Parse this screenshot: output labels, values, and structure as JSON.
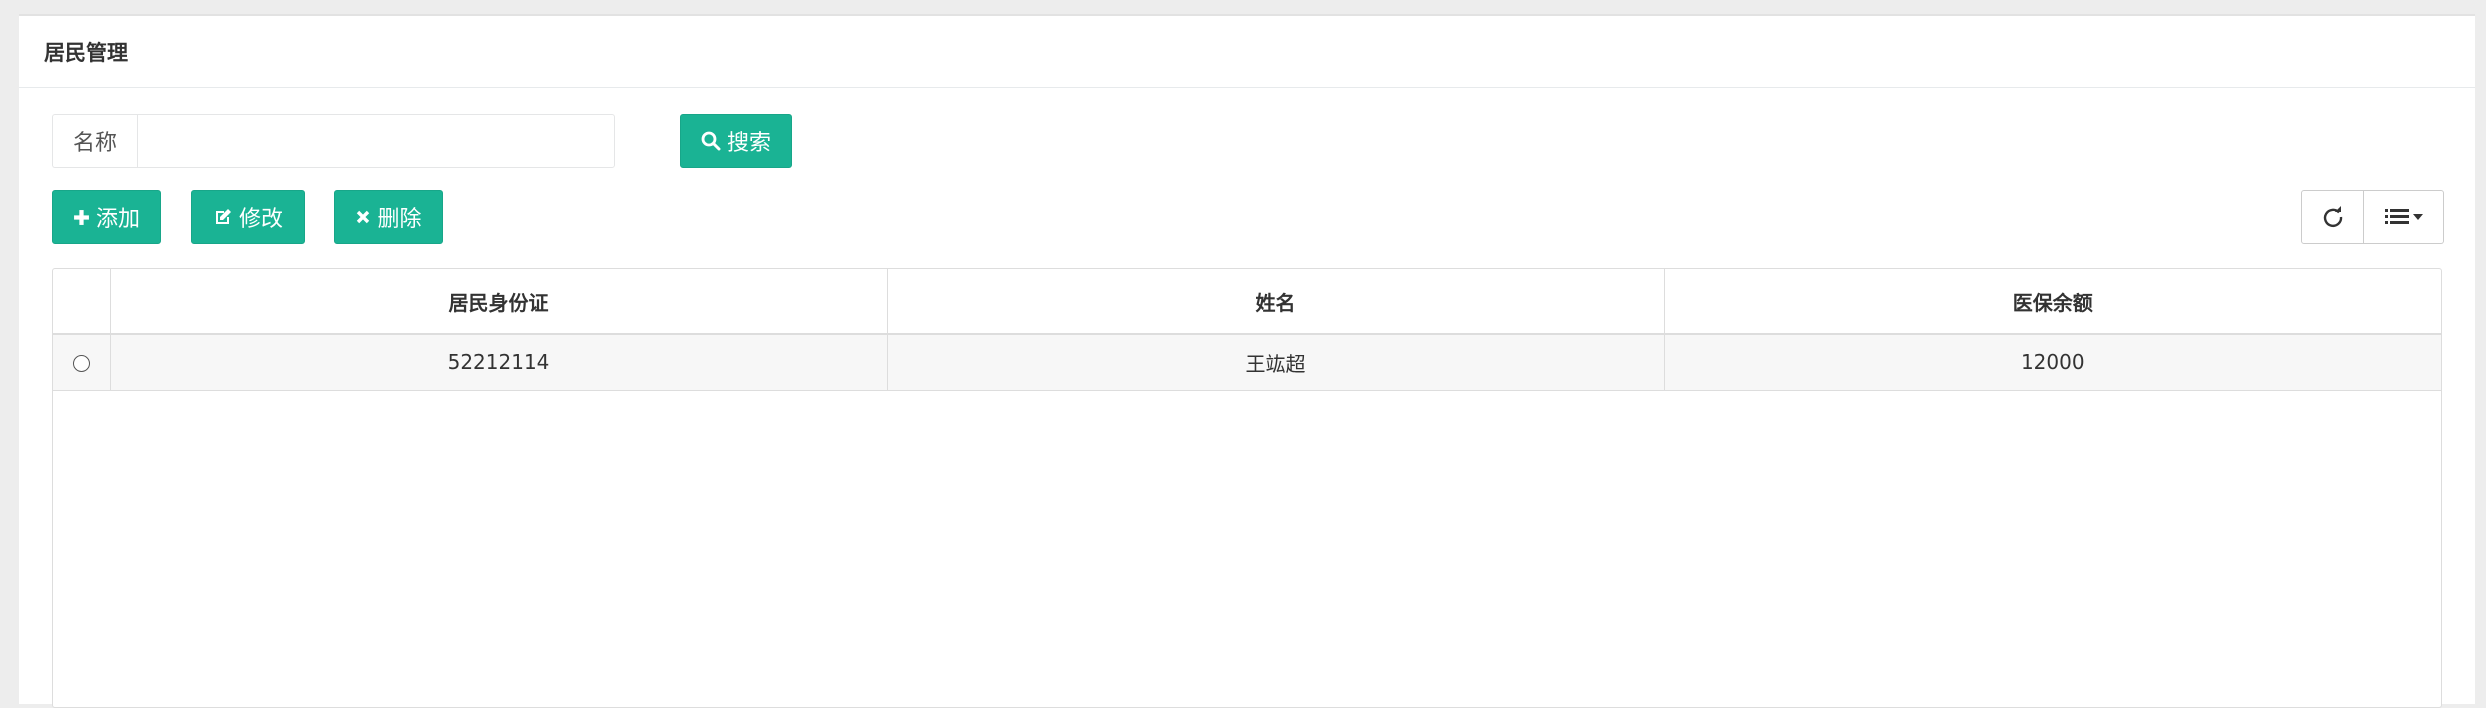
{
  "panel": {
    "title": "居民管理"
  },
  "search": {
    "label": "名称",
    "value": "",
    "placeholder": "",
    "button_label": "搜索",
    "button_icon": "search-icon"
  },
  "toolbar": {
    "add_label": "添加",
    "edit_label": "修改",
    "delete_label": "删除",
    "refresh_icon": "refresh-icon",
    "columns_icon": "list-icon"
  },
  "table": {
    "columns": [
      "居民身份证",
      "姓名",
      "医保余额"
    ],
    "rows": [
      {
        "id_card": "52212114",
        "name": "王竑超",
        "balance": "12000",
        "selected": false
      }
    ]
  },
  "colors": {
    "primary": "#1ab394",
    "background": "#ededed",
    "row_bg": "#f7f7f7"
  }
}
